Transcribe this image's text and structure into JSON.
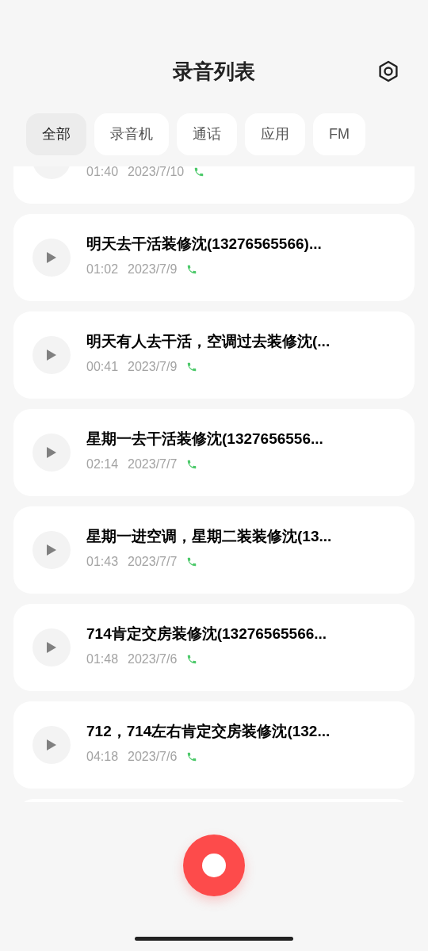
{
  "header": {
    "title": "录音列表"
  },
  "tabs": [
    {
      "label": "全部",
      "selected": true
    },
    {
      "label": "录音机",
      "selected": false
    },
    {
      "label": "通话",
      "selected": false
    },
    {
      "label": "应用",
      "selected": false
    },
    {
      "label": "FM",
      "selected": false
    }
  ],
  "recordings": [
    {
      "duration": "01:40",
      "date": "2023/7/10",
      "kind": "call"
    },
    {
      "title": "明天去干活装修沈(13276565566)...",
      "duration": "01:02",
      "date": "2023/7/9",
      "kind": "call"
    },
    {
      "title": "明天有人去干活，空调过去装修沈(...",
      "duration": "00:41",
      "date": "2023/7/9",
      "kind": "call"
    },
    {
      "title": "星期一去干活装修沈(1327656556...",
      "duration": "02:14",
      "date": "2023/7/7",
      "kind": "call"
    },
    {
      "title": "星期一进空调，星期二装装修沈(13...",
      "duration": "01:43",
      "date": "2023/7/7",
      "kind": "call"
    },
    {
      "title": "714肯定交房装修沈(13276565566...",
      "duration": "01:48",
      "date": "2023/7/6",
      "kind": "call"
    },
    {
      "title": "712，714左右肯定交房装修沈(132...",
      "duration": "04:18",
      "date": "2023/7/6",
      "kind": "call"
    }
  ]
}
